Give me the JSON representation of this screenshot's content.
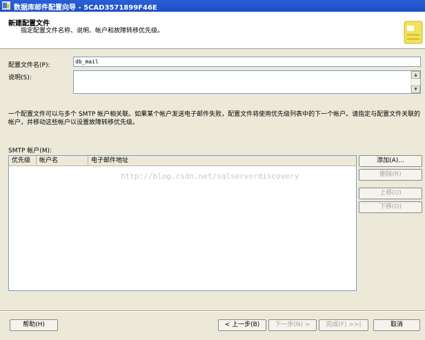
{
  "window": {
    "title": "数据库邮件配置向导 - 5CAD3571899F46E"
  },
  "header": {
    "title": "新建配置文件",
    "subtitle": "指定配置文件名称、说明、帐户和故障转移优先级。"
  },
  "form": {
    "profile_name_label": "配置文件名(P):",
    "profile_name_value": "db_mail",
    "description_label": "说明(S):",
    "description_value": ""
  },
  "info_text": "一个配置文件可以与多个 SMTP 帐户相关联。如果某个帐户发送电子邮件失败，配置文件将使用优先级列表中的下一个帐户。请指定与配置文件关联的帐户，并移动这些帐户以设置故障转移优先级。",
  "smtp": {
    "label": "SMTP 帐户(M):",
    "columns": [
      "优先级",
      "帐户名",
      "电子邮件地址"
    ],
    "rows": []
  },
  "side_buttons": {
    "add": "添加(A)...",
    "remove": "删除(R)",
    "up": "上移(U)",
    "down": "下移(O)"
  },
  "watermark": "http://blog.csdn.net/sqlserverdiscovery",
  "footer": {
    "help": "帮助(H)",
    "back": "< 上一步(B)",
    "next": "下一步(N) >",
    "finish": "完成(F) >>|",
    "cancel": "取消"
  },
  "colors": {
    "titlebar": "#2a5fd6",
    "dialog": "#ece9d8",
    "disabled_text": "#a8a49a"
  }
}
